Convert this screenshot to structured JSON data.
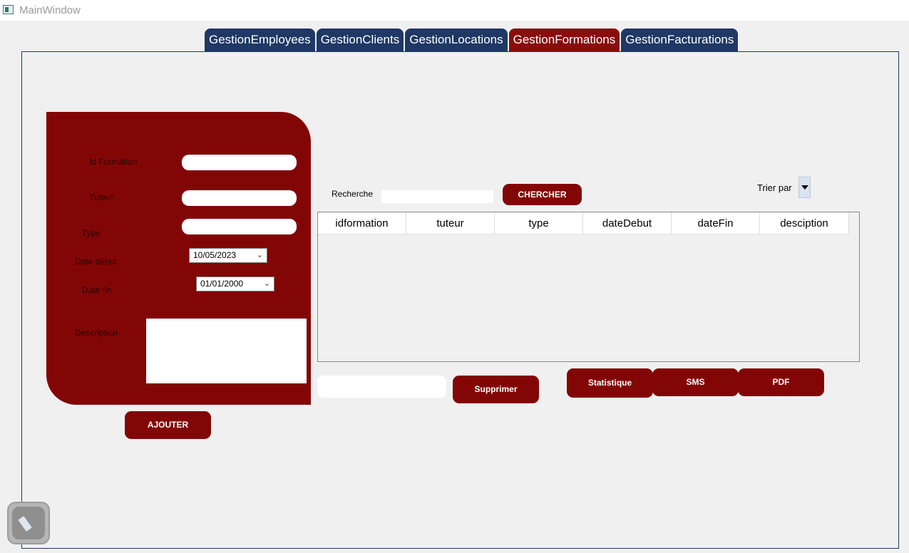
{
  "window": {
    "title": "MainWindow"
  },
  "tabs": [
    {
      "label": "GestionEmployees",
      "active": false
    },
    {
      "label": "GestionClients",
      "active": false
    },
    {
      "label": "GestionLocations",
      "active": false
    },
    {
      "label": "GestionFormations",
      "active": true
    },
    {
      "label": "GestionFacturations",
      "active": false
    }
  ],
  "form": {
    "id_label": "Id Formation",
    "tuteur_label": "Tuteur",
    "type_label": "Type",
    "date_debut_label": "Date début",
    "date_debut_value": "10/05/2023",
    "date_fin_label": "Date fin",
    "date_fin_value": "01/01/2000",
    "description_label": "Description",
    "add_button": "AJOUTER"
  },
  "search": {
    "label": "Recherche",
    "button": "CHERCHER"
  },
  "sort": {
    "label": "Trier par"
  },
  "table": {
    "columns": [
      "idformation",
      "tuteur",
      "type",
      "dateDebut",
      "dateFin",
      "desciption"
    ]
  },
  "actions": {
    "delete_button": "Supprimer",
    "stats_button": "Statistique",
    "sms_button": "SMS",
    "pdf_button": "PDF"
  },
  "colors": {
    "accent": "#830606",
    "tab_inactive": "#1f3864",
    "tab_active": "#880e0e"
  },
  "icons": {
    "app": "app-window-icon",
    "date_dropdown": "chevron-down-icon",
    "sort_dropdown": "triangle-down-icon",
    "floating": "pen-icon"
  }
}
